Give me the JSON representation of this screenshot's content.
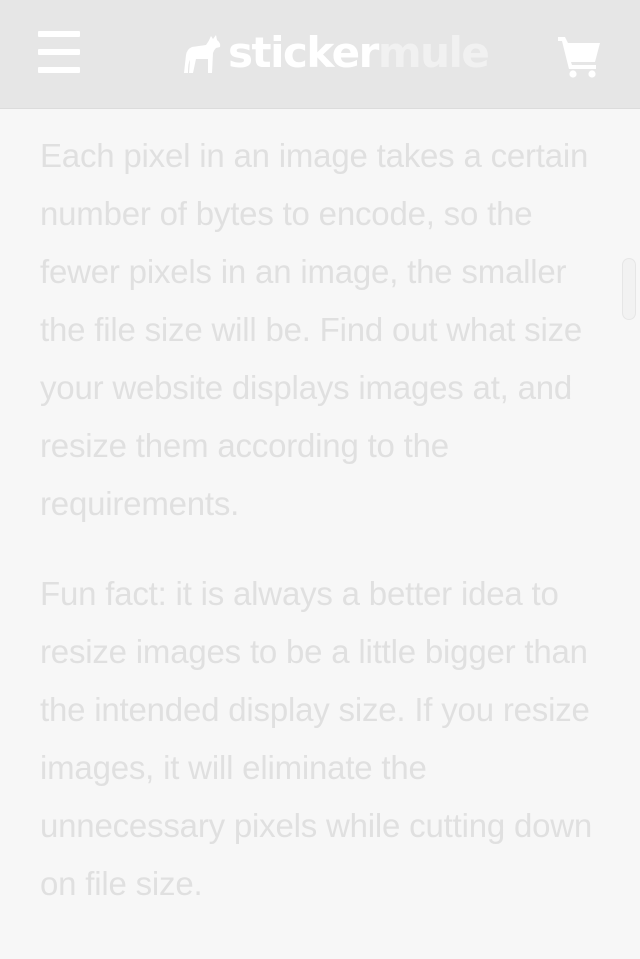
{
  "header": {
    "menu_icon": "hamburger-menu-icon",
    "logo": {
      "part1": "sticker",
      "part2": "mule",
      "icon": "mule-silhouette-icon"
    },
    "cart_icon": "shopping-cart-icon"
  },
  "article": {
    "paragraphs": [
      "Each pixel in an image takes a certain number of bytes to encode, so the fewer pixels in an image, the smaller the file size will be. Find out what size your website displays images at, and resize them according to the requirements.",
      "Fun fact: it is always a better idea to resize images to be a little bigger than the intended display size. If you resize images, it will eliminate the unnecessary pixels while cutting down on file size."
    ]
  },
  "colors": {
    "header_bg": "#e6e6e6",
    "page_bg": "#f7f7f7",
    "text": "#e0e0e0",
    "icon": "#ffffff"
  }
}
